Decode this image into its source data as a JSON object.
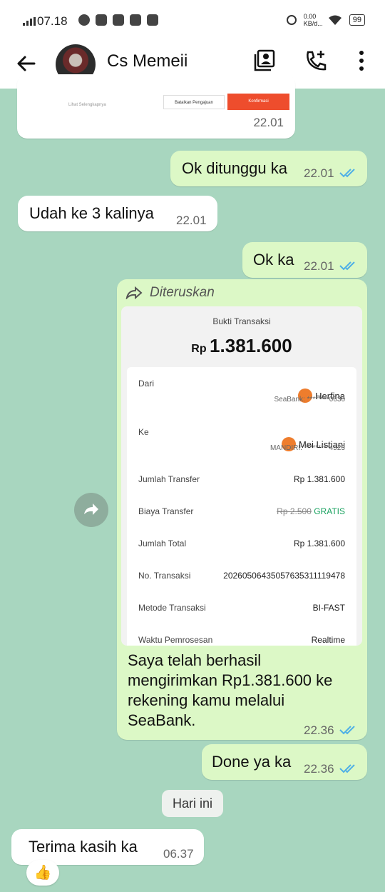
{
  "status_bar": {
    "time": "07.18",
    "net_speed": "0.00 KB/d...",
    "battery": "99"
  },
  "header": {
    "contact_name": "Cs Memeii"
  },
  "messages": {
    "top_card": {
      "link": "Lihat Selengkapnya",
      "cancel_button": "Batalkan Pengajuan",
      "confirm_button": "Konfirmasi",
      "time": "22.01"
    },
    "m1": {
      "text": "Ok ditunggu ka",
      "time": "22.01"
    },
    "m2": {
      "text": "Udah ke 3 kalinya",
      "time": "22.01"
    },
    "m3": {
      "text": "Ok ka",
      "time": "22.01"
    },
    "forwarded_label": "Diteruskan",
    "receipt": {
      "title": "Bukti Transaksi",
      "currency": "Rp",
      "amount": "1.381.600",
      "from_label": "Dari",
      "from_name": "Herfina",
      "from_bank": "SeaBank: ********0636",
      "to_label": "Ke",
      "to_name": "Mei Listiani",
      "to_bank": "MANDIRI: *********4523",
      "transfer_label": "Jumlah Transfer",
      "transfer_value": "Rp 1.381.600",
      "fee_label": "Biaya Transfer",
      "fee_old": "Rp 2.500",
      "fee_new": "GRATIS",
      "total_label": "Jumlah Total",
      "total_value": "Rp 1.381.600",
      "txn_label": "No. Transaksi",
      "txn_value": "20260506435057635311119478",
      "method_label": "Metode Transaksi",
      "method_value": "BI-FAST",
      "process_label": "Waktu Pemrosesan",
      "process_value": "Realtime"
    },
    "m4": {
      "text": "Saya telah berhasil mengirimkan Rp1.381.600 ke rekening kamu melalui SeaBank.",
      "time": "22.36"
    },
    "m5": {
      "text": "Done ya ka",
      "time": "22.36"
    },
    "day_divider": "Hari ini",
    "m6": {
      "text": "Terima kasih ka",
      "time": "06.37",
      "reaction": "👍"
    }
  },
  "colors": {
    "chat_bg": "#a8d6bf",
    "outgoing": "#dcf8c6",
    "tick_blue": "#4fb0e6",
    "confirm_red": "#ee4d2d"
  }
}
